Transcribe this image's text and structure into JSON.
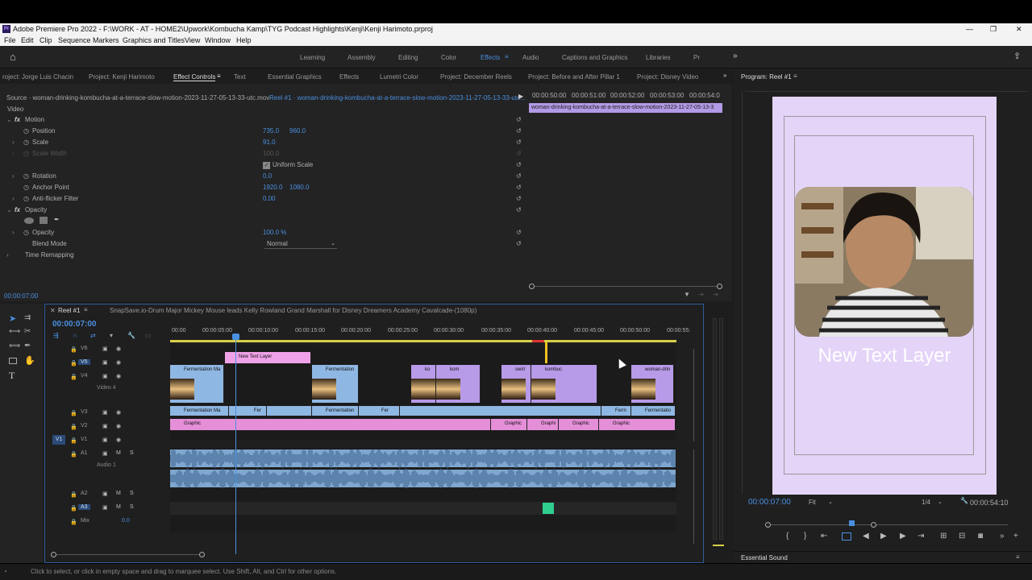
{
  "window": {
    "title": "Adobe Premiere Pro 2022 - F:\\WORK - AT - HOME2\\Upwork\\Kombucha Kamp\\TYG Podcast Highlights\\Kenji\\Kenji Harimoto.prproj",
    "app_badge": "Pr"
  },
  "menu": [
    "File",
    "Edit",
    "Clip",
    "Sequence",
    "Markers",
    "Graphics and Titles",
    "View",
    "Window",
    "Help"
  ],
  "workspaces": [
    "Learning",
    "Assembly",
    "Editing",
    "Color",
    "Effects",
    "Audio",
    "Captions and Graphics",
    "Libraries",
    "Pr"
  ],
  "workspace_active": "Effects",
  "panel_tabs": [
    "roject: Jorge Luis Chacin",
    "Project: Kenji Harimoto",
    "Effect Controls",
    "Text",
    "Essential Graphics",
    "Effects",
    "Lumetri Color",
    "Project: December Reels",
    "Project: Before and After Pillar 1",
    "Project: Disney Video"
  ],
  "effect_controls": {
    "source": "Source · woman-drinking-kombucha-at-a-terrace-slow-motion-2023-11-27-05-13-33-utc.mov",
    "sequence": "Reel #1 · woman-drinking-kombucha-at-a-terrace-slow-motion-2023-11-27-05-13-33-utc...",
    "timecodes": [
      "00:00:50:00",
      "00:00:51:00",
      "00:00:52:00",
      "00:00:53:00",
      "00:00:54:0"
    ],
    "clip_bar": "woman-drinking-kombucha-at-a-terrace-slow-motion-2023-11-27-05-13-3",
    "section_video": "Video",
    "motion": "Motion",
    "position_label": "Position",
    "position_x": "735.0",
    "position_y": "960.0",
    "scale_label": "Scale",
    "scale_value": "91.0",
    "scale_width_label": "Scale Width",
    "scale_width_value": "100.0",
    "uniform_scale": "Uniform Scale",
    "rotation_label": "Rotation",
    "rotation_value": "0.0",
    "anchor_label": "Anchor Point",
    "anchor_x": "1920.0",
    "anchor_y": "1080.0",
    "antiflicker_label": "Anti-flicker Filter",
    "antiflicker_value": "0.00",
    "opacity_section": "Opacity",
    "opacity_label": "Opacity",
    "opacity_value": "100.0 %",
    "blend_label": "Blend Mode",
    "blend_value": "Normal",
    "time_remap": "Time Remapping",
    "current_time": "00:00:07:00"
  },
  "timeline": {
    "tab": "Reel #1",
    "tab2": "SnapSave.io-Drum Major Mickey Mouse leads Kelly Rowland Grand Marshall for Disney Dreamers Academy Cavalcade-(1080p)",
    "timecode": "00:00:07:00",
    "ruler": [
      "00:00",
      "00:00:05:00",
      "00:00:10:00",
      "00:00:15:00",
      "00:00:20:00",
      "00:00:25:00",
      "00:00:30:00",
      "00:00:35:00",
      "00:00:40:00",
      "00:00:45:00",
      "00:00:50:00",
      "00:00:55:"
    ],
    "tracks_video": [
      {
        "id": "V6",
        "name": ""
      },
      {
        "id": "V5",
        "name": ""
      },
      {
        "id": "V4",
        "name": "Video 4"
      },
      {
        "id": "V3",
        "name": ""
      },
      {
        "id": "V2",
        "name": ""
      },
      {
        "id": "V1",
        "name": ""
      }
    ],
    "tracks_audio": [
      {
        "id": "A1",
        "name": "Audio 1"
      },
      {
        "id": "A2",
        "name": ""
      },
      {
        "id": "A3",
        "name": ""
      },
      {
        "id": "Mix",
        "name": "0.0"
      }
    ],
    "audio_vol": "0.",
    "clips": {
      "v5_text": "New Text Layer",
      "v4": [
        "Fermentation Ma",
        "Fermentation",
        "ko",
        "kom",
        "swirl",
        "kombuc",
        "woman-drin"
      ],
      "v3": [
        "Fermentation Ma",
        "Fer",
        "Fermentation",
        "Fer",
        "Ferm",
        "Fermentatio"
      ],
      "v2": [
        "Graphic",
        "Graphic",
        "Graphi",
        "Graphic",
        "Graphic"
      ]
    }
  },
  "program": {
    "title": "Program: Reel #1",
    "overlay_text": "New Text Layer",
    "timecode": "00:00:07:00",
    "fit": "Fit",
    "resolution": "1/4",
    "duration": "00:00:54:10",
    "essential_sound": "Essential Sound"
  },
  "status": "Click to select, or click in empty space and drag to marquee select. Use Shift, Alt, and Ctrl for other options.",
  "colors": {
    "accent": "#4a8fe0",
    "clip_blue": "#8fb7e3",
    "clip_pink": "#e58fd8",
    "clip_purple": "#b79ae8",
    "frame_bg": "#e4d4f8",
    "playhead": "#f0c020"
  }
}
